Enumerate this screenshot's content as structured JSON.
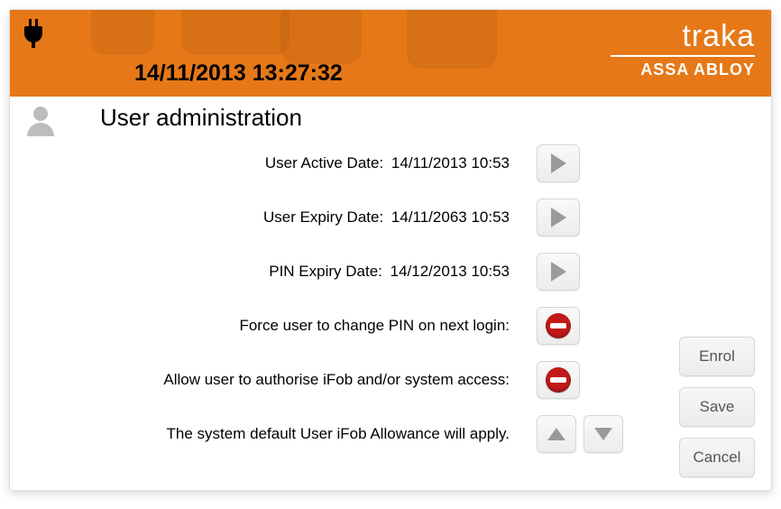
{
  "header": {
    "datetime": "14/11/2013 13:27:32",
    "brand": "traka",
    "brand_sub": "ASSA ABLOY"
  },
  "page": {
    "title": "User administration"
  },
  "fields": {
    "active_date": {
      "label": "User Active Date:",
      "value": "14/11/2013 10:53"
    },
    "expiry_date": {
      "label": "User Expiry Date:",
      "value": "14/11/2063 10:53"
    },
    "pin_expiry": {
      "label": "PIN Expiry Date:",
      "value": "14/12/2013 10:53"
    },
    "force_pin": {
      "label": "Force user to change PIN on next login:"
    },
    "authorise": {
      "label": "Allow user to authorise iFob and/or system access:"
    },
    "allowance": {
      "label": "The system default User iFob Allowance will apply."
    }
  },
  "buttons": {
    "enrol": "Enrol",
    "save": "Save",
    "cancel": "Cancel"
  }
}
